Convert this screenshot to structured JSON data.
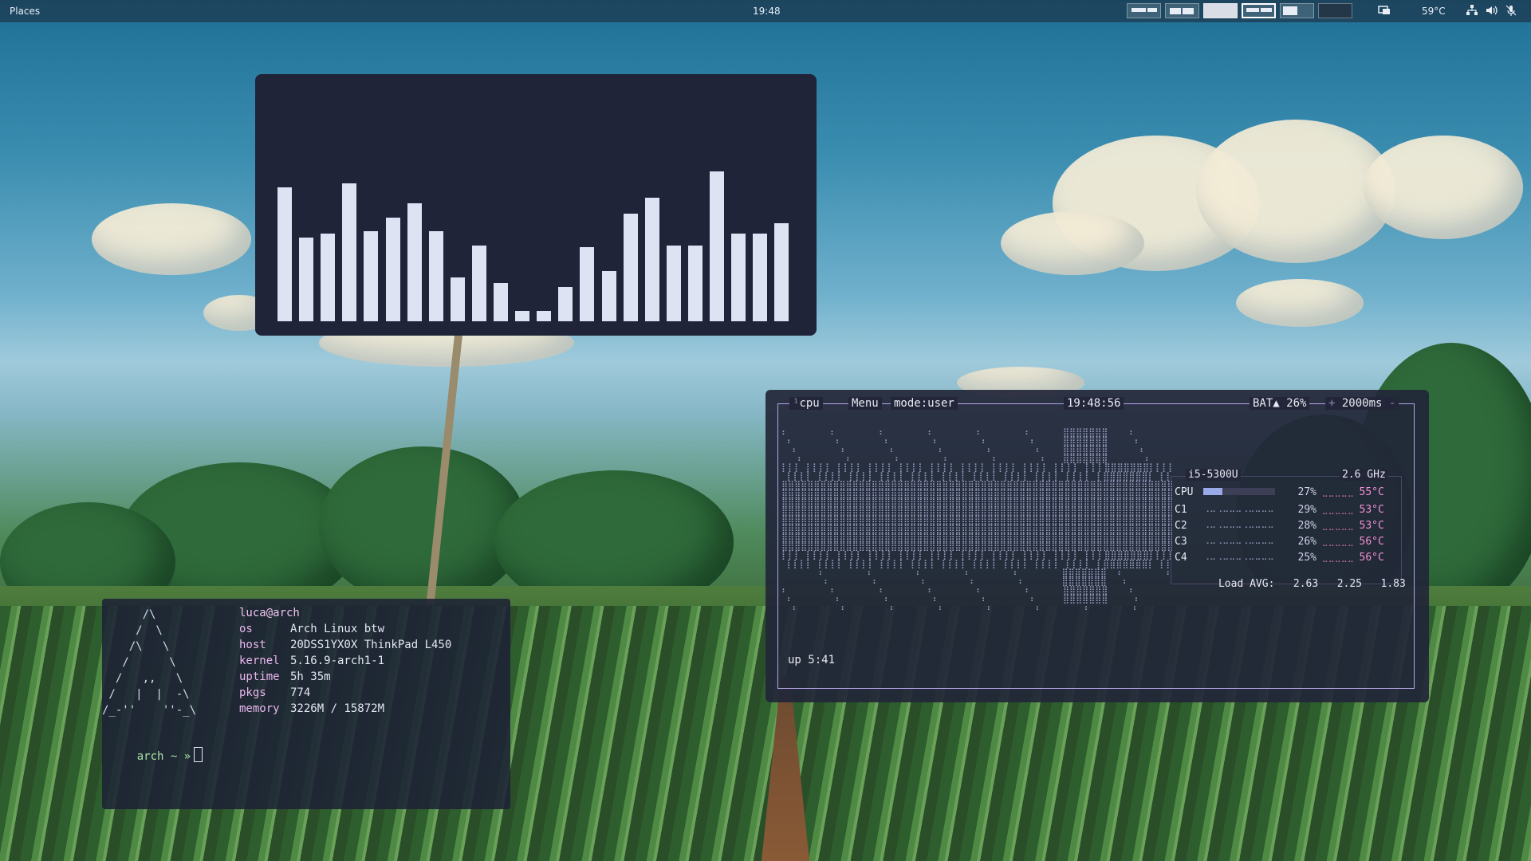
{
  "topbar": {
    "places": "Places",
    "clock": "19:48",
    "temperature": "59°C"
  },
  "visualizer": {
    "bars": [
      0.67,
      0.42,
      0.44,
      0.69,
      0.45,
      0.52,
      0.59,
      0.45,
      0.22,
      0.38,
      0.19,
      0.05,
      0.05,
      0.17,
      0.37,
      0.25,
      0.54,
      0.62,
      0.38,
      0.38,
      0.75,
      0.44,
      0.44,
      0.49
    ],
    "bar_color": "#dde3f3"
  },
  "fetch": {
    "logo": [
      "      /\\",
      "     /  \\",
      "    /\\   \\",
      "   /      \\",
      "  /   ,,   \\",
      " /   |  |  -\\",
      "/_-''    ''-_\\"
    ],
    "user": "luca@arch",
    "fields": [
      {
        "key": "os",
        "value": "Arch Linux btw"
      },
      {
        "key": "host",
        "value": "20DSS1YX0X ThinkPad L450"
      },
      {
        "key": "kernel",
        "value": "5.16.9-arch1-1"
      },
      {
        "key": "uptime",
        "value": "5h 35m"
      },
      {
        "key": "pkgs",
        "value": "774"
      },
      {
        "key": "memory",
        "value": "3226M / 15872M"
      }
    ],
    "prompt": "arch ~ »"
  },
  "btop": {
    "tab_num": "¹",
    "tab": "cpu",
    "menu": "Menu",
    "mode": "mode:user",
    "time": "19:48:56",
    "battery": "BAT▲ 26%",
    "interval": "2000ms",
    "cpu_model": "i5-5300U",
    "freq": "2.6 GHz",
    "rows": [
      {
        "label": "CPU",
        "pct": "27%",
        "temp": "55°C"
      },
      {
        "label": "C1",
        "pct": "29%",
        "temp": "53°C"
      },
      {
        "label": "C2",
        "pct": "28%",
        "temp": "53°C"
      },
      {
        "label": "C3",
        "pct": "26%",
        "temp": "56°C"
      },
      {
        "label": "C4",
        "pct": "25%",
        "temp": "56°C"
      }
    ],
    "load_label": "Load AVG:",
    "load": [
      "2.63",
      "2.25",
      "1.83"
    ],
    "uptime": "up 5:41",
    "accent": "#b7a4ee"
  }
}
